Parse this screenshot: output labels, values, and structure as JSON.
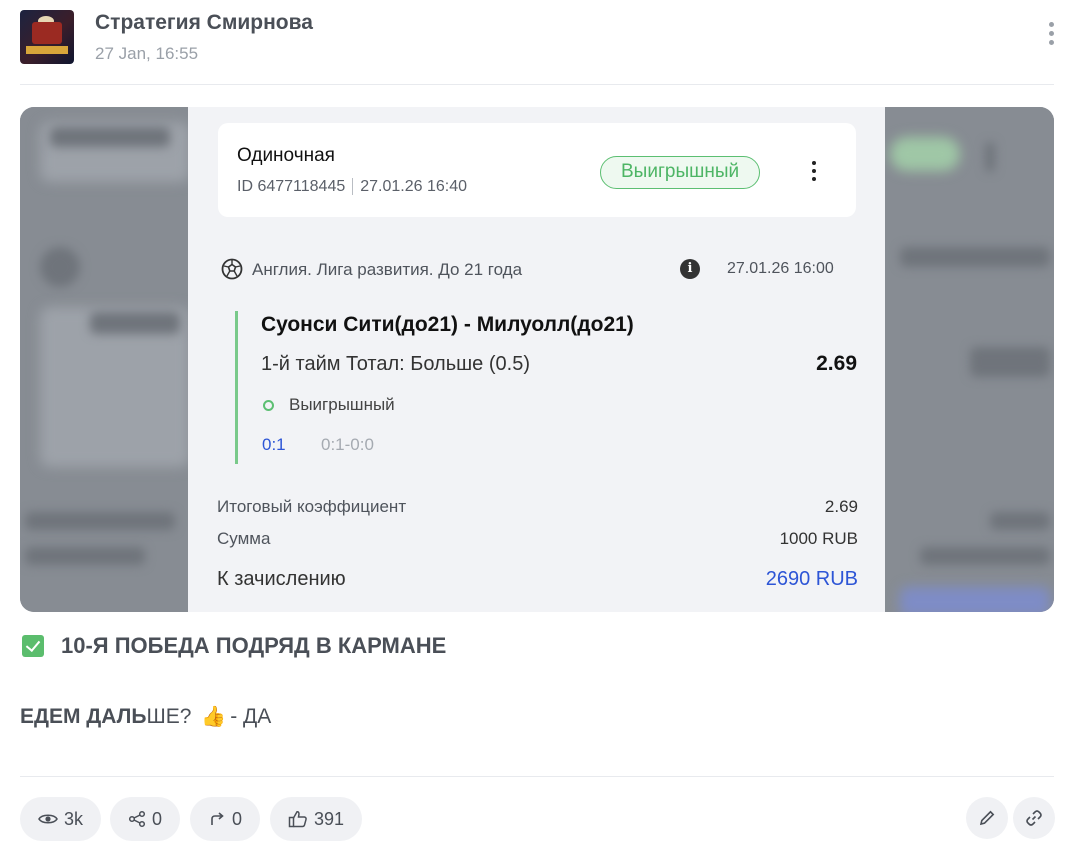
{
  "post": {
    "channel_name": "Стратегия Смирнова",
    "time": "27 Jan, 16:55"
  },
  "bet": {
    "type": "Одиночная",
    "id": "ID 6477118445",
    "datetime": "27.01.26 16:40",
    "status": "Выигрышный",
    "league": "Англия. Лига развития. До 21 года",
    "event_time": "27.01.26 16:00",
    "match": "Суонси Сити(до21) - Милуолл(до21)",
    "market": "1-й тайм Тотал: Больше (0.5)",
    "odds": "2.69",
    "result_status": "Выигрышный",
    "score": "0:1",
    "score_detail": "0:1-0:0",
    "summary": {
      "total_odds_label": "Итоговый коэффициент",
      "total_odds_value": "2.69",
      "stake_label": "Сумма",
      "stake_value": "1000 RUB",
      "payout_label": "К зачислению",
      "payout_value": "2690 RUB"
    }
  },
  "caption": {
    "line1": "10-Я ПОБЕДА ПОДРЯД В КАРМАНЕ",
    "line2_bold": "ЕДЕМ ДАЛЬ",
    "line2_rest": "ШЕ?",
    "line2_emoji": "👍",
    "line2_tail": "- ДА"
  },
  "actions": {
    "views": "3k",
    "shares": "0",
    "forwards": "0",
    "likes": "391"
  },
  "colors": {
    "win_green": "#5cbf72",
    "link_blue": "#2d55d6"
  }
}
